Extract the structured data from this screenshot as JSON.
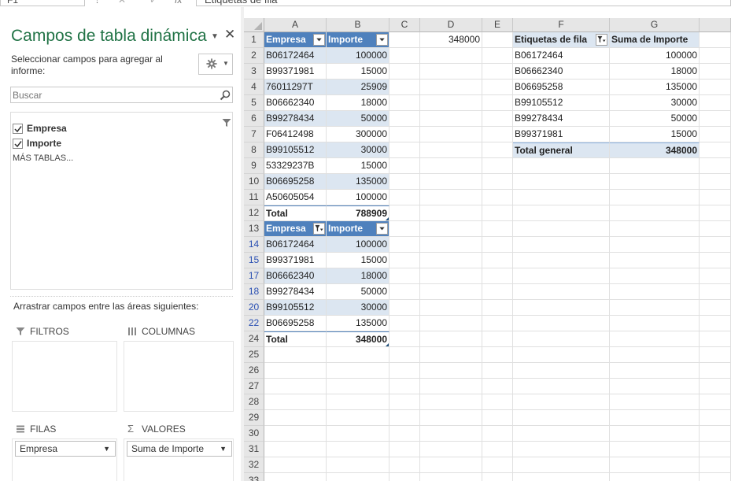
{
  "formula_bar": {
    "name_box": "F1",
    "fx_label": "fx",
    "content": "Etiquetas de fila"
  },
  "pane": {
    "title": "Campos de tabla dinámica",
    "subtitle": "Seleccionar campos para agregar al informe:",
    "search_placeholder": "Buscar",
    "fields": [
      {
        "label": "Empresa",
        "checked": true
      },
      {
        "label": "Importe",
        "checked": true
      }
    ],
    "more_tables": "MÁS TABLAS...",
    "drag_label": "Arrastrar campos entre las áreas siguientes:",
    "areas": {
      "filters": "FILTROS",
      "columns": "COLUMNAS",
      "rows": "FILAS",
      "values": "VALORES",
      "rows_item": "Empresa",
      "values_item": "Suma de Importe"
    }
  },
  "sheet": {
    "columns": [
      "A",
      "B",
      "C",
      "D",
      "E",
      "F",
      "G"
    ],
    "rows": [
      "1",
      "2",
      "3",
      "4",
      "5",
      "6",
      "7",
      "8",
      "9",
      "10",
      "11",
      "12",
      "13",
      "14",
      "15",
      "17",
      "18",
      "20",
      "22",
      "24",
      "25",
      "26",
      "27",
      "28",
      "29",
      "30",
      "31",
      "32",
      "33"
    ],
    "filtered_rows": [
      "14",
      "15",
      "17",
      "18",
      "20",
      "22"
    ],
    "table1": {
      "headers": [
        "Empresa",
        "Importe"
      ],
      "rows": [
        [
          "B06172464",
          "100000"
        ],
        [
          "B99371981",
          "15000"
        ],
        [
          "76011297T",
          "25909"
        ],
        [
          "B06662340",
          "18000"
        ],
        [
          "B99278434",
          "50000"
        ],
        [
          "F06412498",
          "300000"
        ],
        [
          "B99105512",
          "30000"
        ],
        [
          "53329237B",
          "15000"
        ],
        [
          "B06695258",
          "135000"
        ],
        [
          "A50605054",
          "100000"
        ]
      ],
      "total_label": "Total",
      "total_value": "788909"
    },
    "table2": {
      "headers": [
        "Empresa",
        "Importe"
      ],
      "rows": [
        [
          "B06172464",
          "100000"
        ],
        [
          "B99371981",
          "15000"
        ],
        [
          "B06662340",
          "18000"
        ],
        [
          "B99278434",
          "50000"
        ],
        [
          "B99105512",
          "30000"
        ],
        [
          "B06695258",
          "135000"
        ]
      ],
      "total_label": "Total",
      "total_value": "348000"
    },
    "d1": "348000",
    "pivot": {
      "headers": [
        "Etiquetas de fila",
        "Suma de Importe"
      ],
      "rows": [
        [
          "B06172464",
          "100000"
        ],
        [
          "B06662340",
          "18000"
        ],
        [
          "B06695258",
          "135000"
        ],
        [
          "B99105512",
          "30000"
        ],
        [
          "B99278434",
          "50000"
        ],
        [
          "B99371981",
          "15000"
        ]
      ],
      "total_label": "Total general",
      "total_value": "348000"
    }
  },
  "colors": {
    "accent": "#217346",
    "table_header": "#4f81bd",
    "table_band": "#dce6f1",
    "filtered_row_number": "#2a4fb2"
  }
}
